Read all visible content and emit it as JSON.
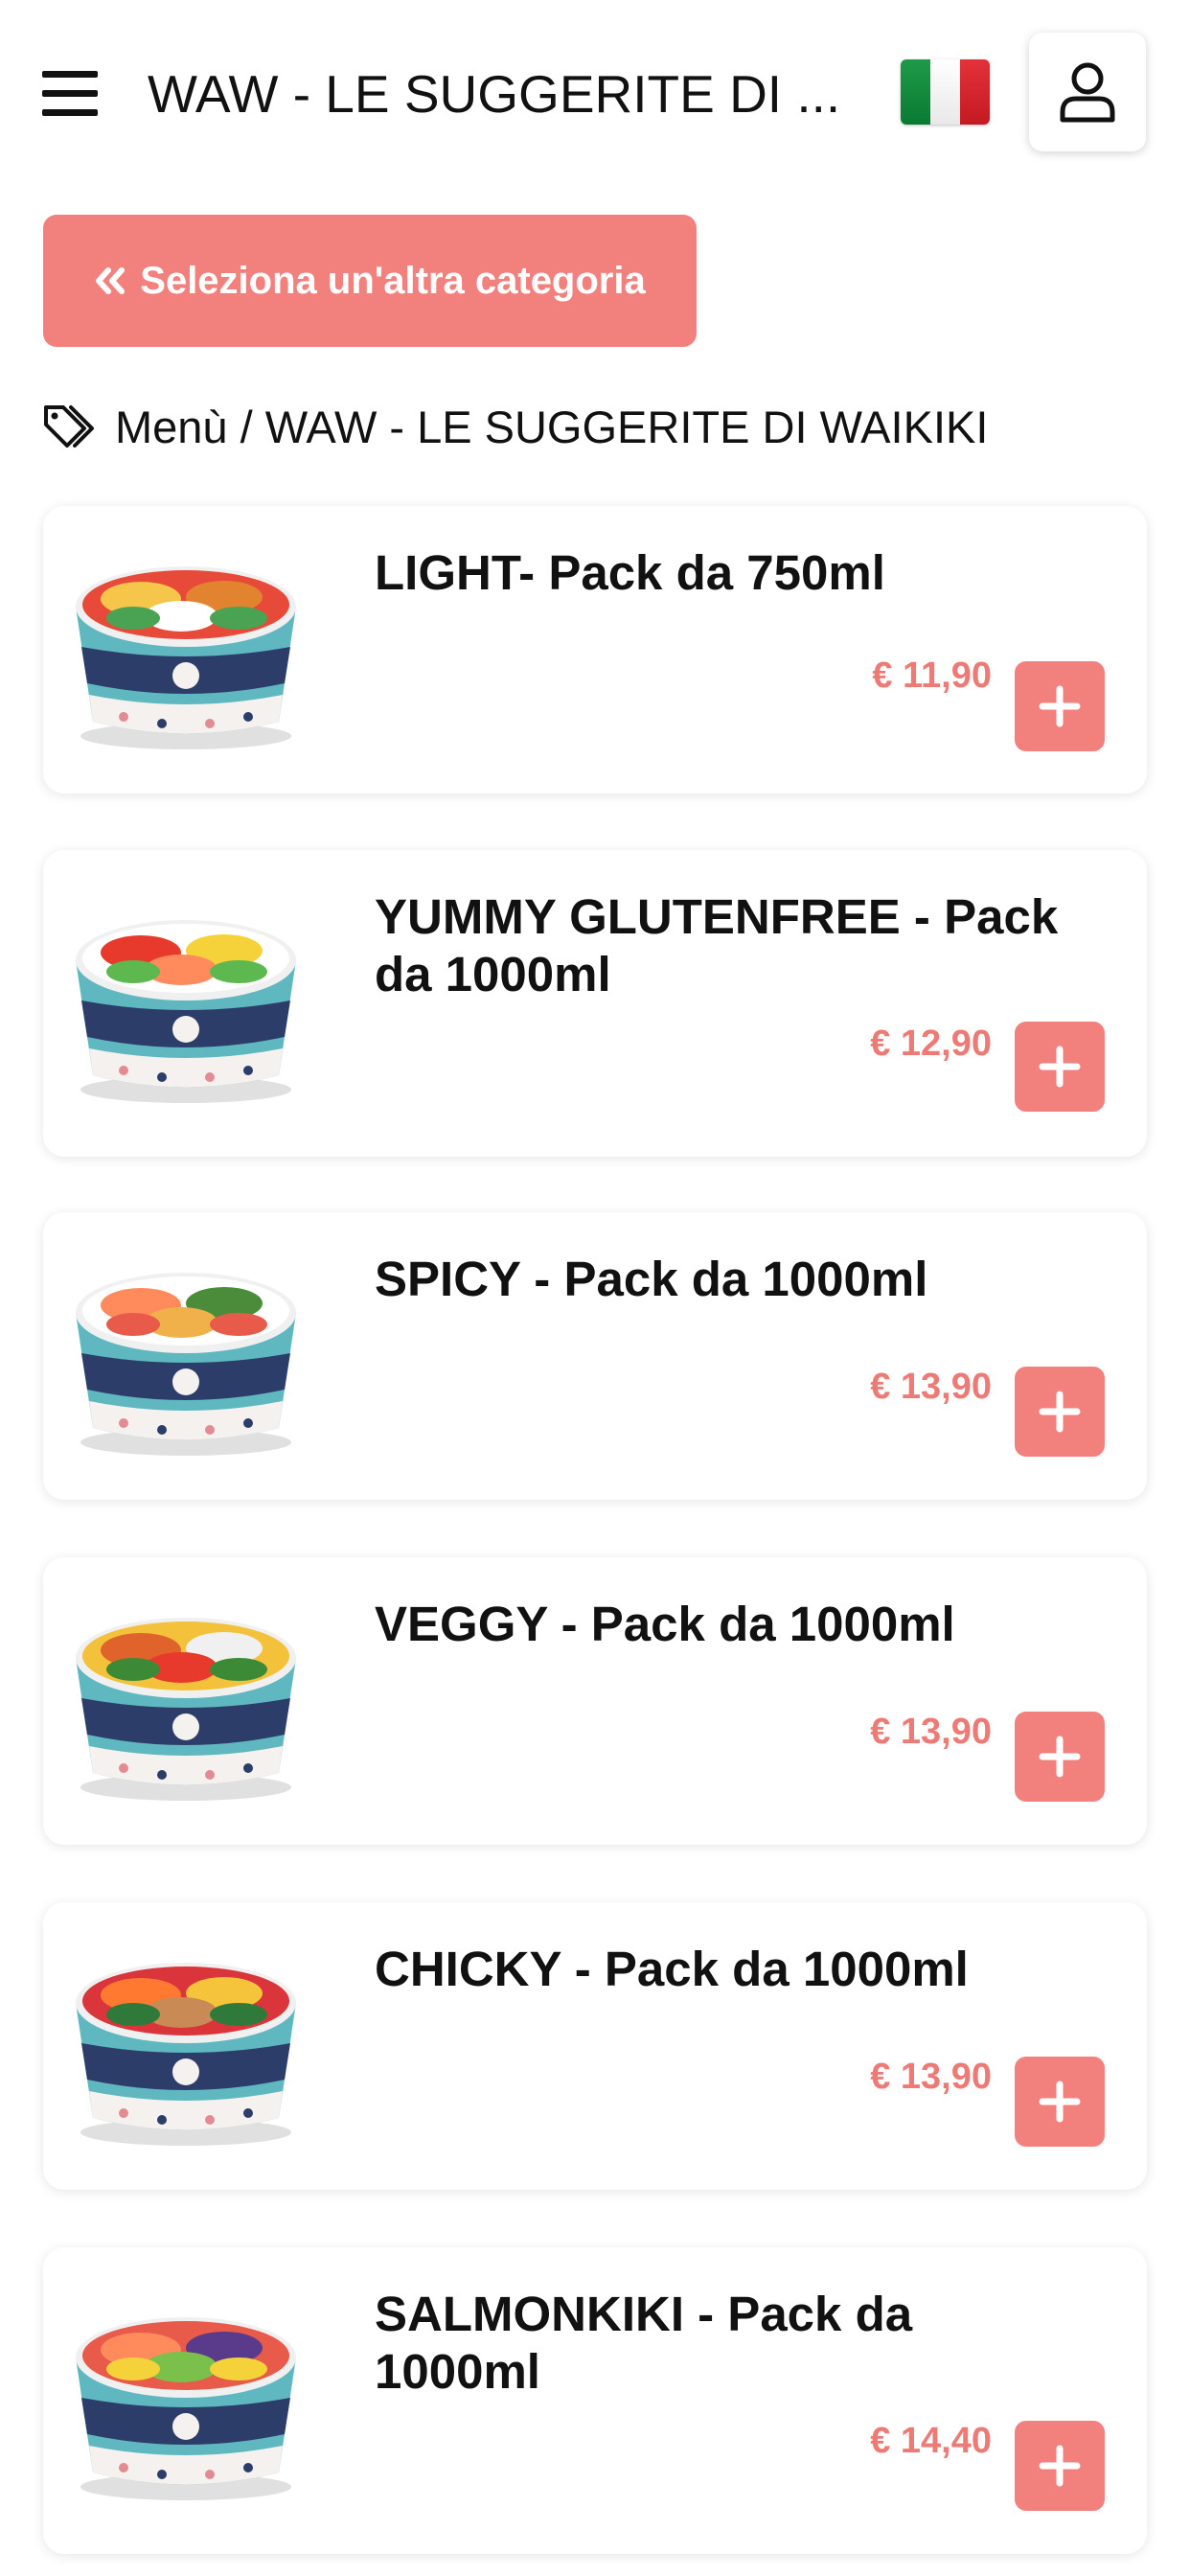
{
  "header": {
    "title": "WAW - LE SUGGERITE DI ...",
    "flag_colors": [
      "#1f9a48",
      "#ffffff",
      "#e2323a"
    ],
    "menu_icon": "hamburger-icon",
    "user_icon": "user-icon"
  },
  "category_button": {
    "label": "Seleziona un'altra categoria",
    "icon": "double-chevron-left-icon"
  },
  "breadcrumb": {
    "icon": "tags-icon",
    "text": "Menù / WAW - LE SUGGERITE DI WAIKIKI"
  },
  "colors": {
    "accent": "#f2817d",
    "price": "#ee7a76"
  },
  "products": [
    {
      "name": "LIGHT- Pack da 750ml",
      "price": "€ 11,90"
    },
    {
      "name": "YUMMY GLUTENFREE - Pack da 1000ml",
      "price": "€ 12,90"
    },
    {
      "name": "SPICY - Pack da 1000ml",
      "price": "€ 13,90"
    },
    {
      "name": "VEGGY - Pack da 1000ml",
      "price": "€ 13,90"
    },
    {
      "name": "CHICKY - Pack da 1000ml",
      "price": "€ 13,90"
    },
    {
      "name": "SALMONKIKI - Pack da 1000ml",
      "price": "€ 14,40"
    }
  ]
}
